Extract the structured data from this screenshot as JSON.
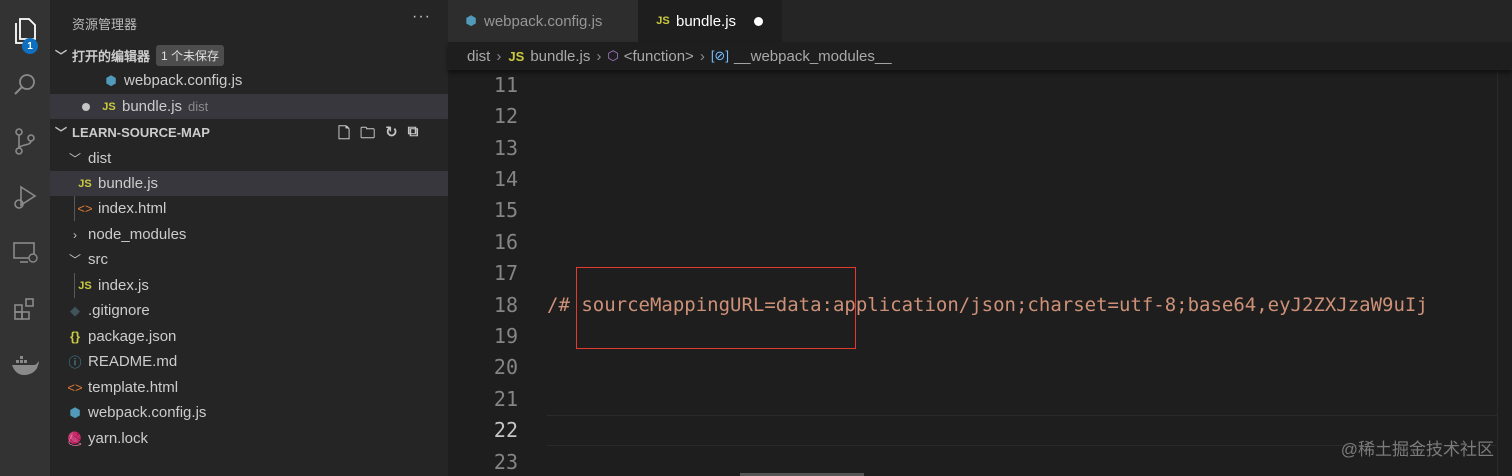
{
  "activity": {
    "explorer_badge": "1"
  },
  "sidebar": {
    "title": "资源管理器",
    "more": "···",
    "open_editors": {
      "label": "打开的编辑器",
      "unsaved_badge": "1 个未保存",
      "items": [
        {
          "name": "webpack.config.js",
          "desc": ""
        },
        {
          "name": "bundle.js",
          "desc": "dist"
        }
      ]
    },
    "project": {
      "label": "LEARN-SOURCE-MAP",
      "tree": [
        {
          "name": "dist",
          "kind": "folder-open"
        },
        {
          "name": "bundle.js",
          "kind": "js"
        },
        {
          "name": "index.html",
          "kind": "html"
        },
        {
          "name": "node_modules",
          "kind": "folder-closed"
        },
        {
          "name": "src",
          "kind": "folder-open"
        },
        {
          "name": "index.js",
          "kind": "js"
        },
        {
          "name": ".gitignore",
          "kind": "git"
        },
        {
          "name": "package.json",
          "kind": "json"
        },
        {
          "name": "README.md",
          "kind": "info"
        },
        {
          "name": "template.html",
          "kind": "html"
        },
        {
          "name": "webpack.config.js",
          "kind": "cfg"
        },
        {
          "name": "yarn.lock",
          "kind": "yarn"
        }
      ]
    }
  },
  "tabs": [
    {
      "label": "webpack.config.js",
      "active": false
    },
    {
      "label": "bundle.js",
      "active": true,
      "dirty": true
    }
  ],
  "breadcrumb": [
    "dist",
    "bundle.js",
    "<function>",
    "__webpack_modules__"
  ],
  "editor": {
    "line_numbers": [
      "11",
      "12",
      "13",
      "14",
      "15",
      "16",
      "17",
      "18",
      "19",
      "20",
      "21",
      "22",
      "23"
    ],
    "current_line": "22",
    "code_line_18": "/# sourceMappingURL=data:application/json;charset=utf-8;base64,eyJ2ZXJzaW9uIj"
  },
  "watermark": "@稀土掘金技术社区",
  "colors": {
    "accent": "#0e70c0",
    "highlight_box": "#e33b2e",
    "string": "#ce9178"
  }
}
